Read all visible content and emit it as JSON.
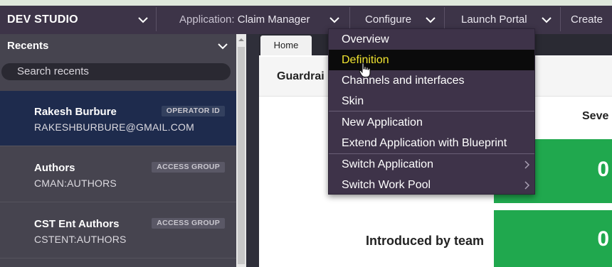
{
  "header": {
    "brand": "DEV STUDIO",
    "application_label": "Application:",
    "application_value": "Claim Manager",
    "configure": "Configure",
    "launch_portal": "Launch Portal",
    "create": "Create"
  },
  "recents": {
    "title": "Recents",
    "search_placeholder": "Search recents",
    "items": [
      {
        "name": "Rakesh Burbure",
        "sub": "RAKESHBURBURE@GMAIL.COM",
        "badge": "OPERATOR ID"
      },
      {
        "name": "Authors",
        "sub": "CMAN:AUTHORS",
        "badge": "ACCESS GROUP"
      },
      {
        "name": "CST Ent Authors",
        "sub": "CSTENT:AUTHORS",
        "badge": "ACCESS GROUP"
      }
    ]
  },
  "main": {
    "tab": "Home",
    "guardrail_title": "Guardrai",
    "severity_header": "Seve",
    "green_value_1": "0",
    "green_value_2": "0",
    "introduced_label": "Introduced by team"
  },
  "menu": {
    "items": [
      {
        "label": "Overview"
      },
      {
        "label": "Definition"
      },
      {
        "label": "Channels and interfaces"
      },
      {
        "label": "Skin"
      },
      {
        "label": "New Application"
      },
      {
        "label": "Extend Application with Blueprint"
      },
      {
        "label": "Switch Application"
      },
      {
        "label": "Switch Work Pool"
      }
    ]
  },
  "colors": {
    "header_bg": "#3d3448",
    "menu_bg": "#3e3349",
    "menu_active_text": "#f0e430",
    "selected_item_bg": "#1e2b4d",
    "success_green": "#20a84e"
  },
  "icons": [
    "chevron-down-icon",
    "chevron-right-icon",
    "scroll-up-arrow-icon",
    "hand-pointer-cursor-icon"
  ]
}
